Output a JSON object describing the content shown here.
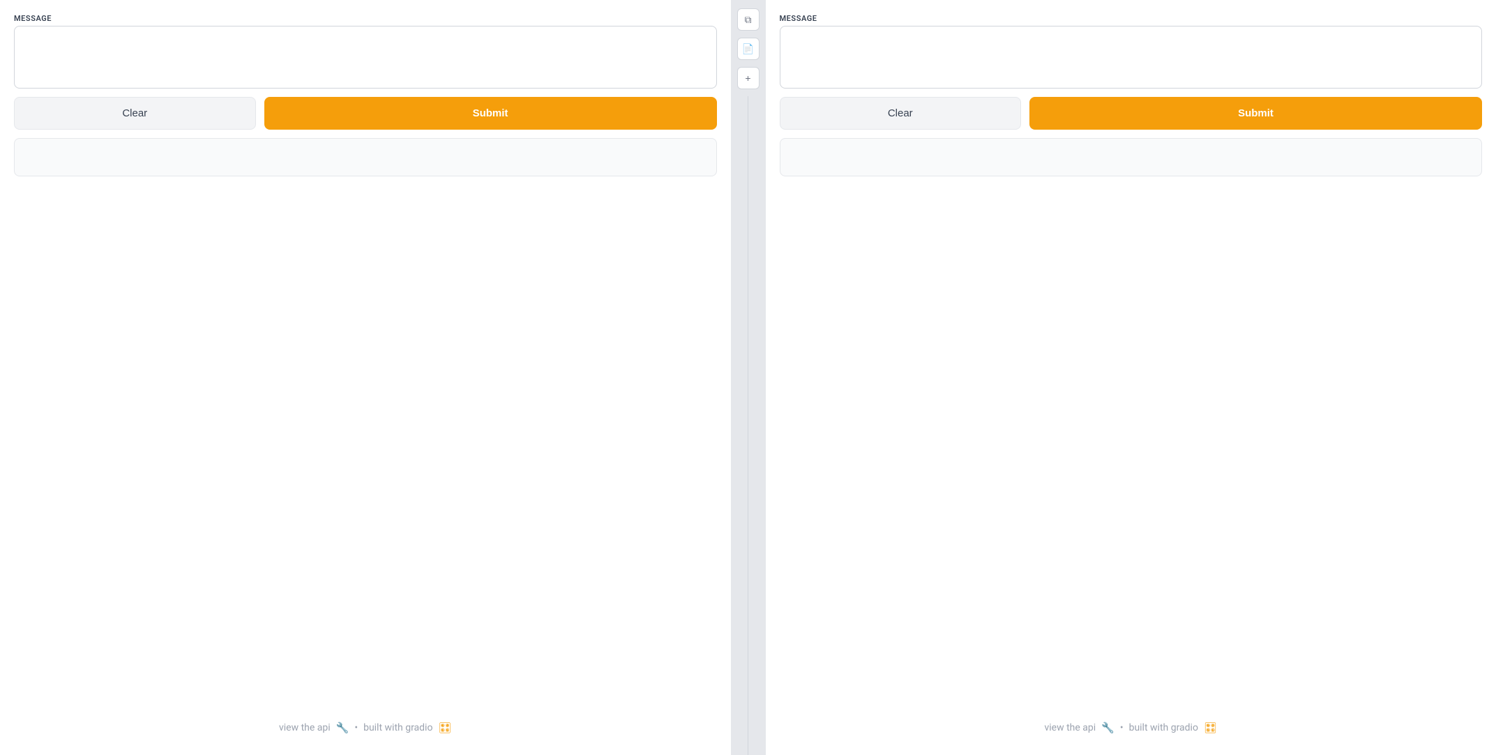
{
  "left_panel": {
    "message_label": "MESSAGE",
    "message_placeholder": "",
    "clear_label": "Clear",
    "submit_label": "Submit",
    "footer": {
      "api_link": "view the api",
      "wrench_emoji": "🔧",
      "dot": "•",
      "built_text": "built with gradio",
      "gradio_emoji": "🎛"
    }
  },
  "right_panel": {
    "message_label": "MESSAGE",
    "message_placeholder": "",
    "clear_label": "Clear",
    "submit_label": "Submit",
    "footer": {
      "api_link": "view the api",
      "wrench_emoji": "🔧",
      "dot": "•",
      "built_text": "built with gradio",
      "gradio_emoji": "🎛"
    }
  },
  "divider": {
    "copy_icon": "⧉",
    "file_icon": "📄",
    "plus_icon": "+"
  },
  "colors": {
    "submit_bg": "#f59e0b",
    "clear_bg": "#f3f4f6"
  }
}
